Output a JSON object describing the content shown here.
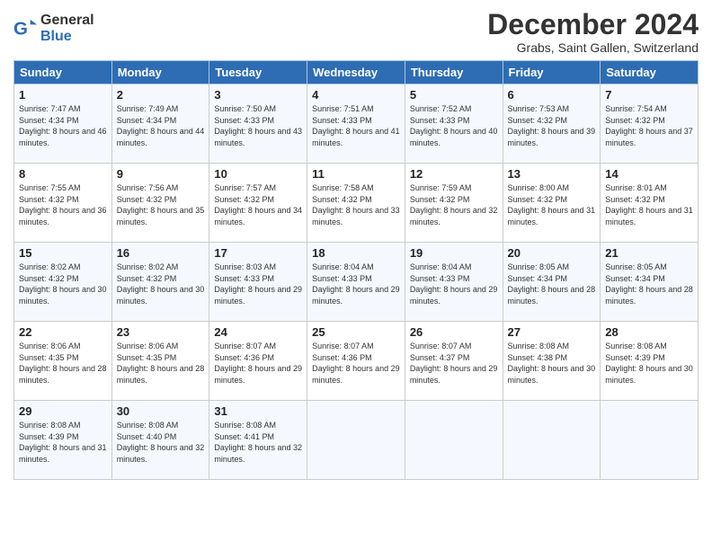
{
  "header": {
    "logo_general": "General",
    "logo_blue": "Blue",
    "month_title": "December 2024",
    "subtitle": "Grabs, Saint Gallen, Switzerland"
  },
  "weekdays": [
    "Sunday",
    "Monday",
    "Tuesday",
    "Wednesday",
    "Thursday",
    "Friday",
    "Saturday"
  ],
  "weeks": [
    [
      {
        "day": "1",
        "sunrise": "Sunrise: 7:47 AM",
        "sunset": "Sunset: 4:34 PM",
        "daylight": "Daylight: 8 hours and 46 minutes."
      },
      {
        "day": "2",
        "sunrise": "Sunrise: 7:49 AM",
        "sunset": "Sunset: 4:34 PM",
        "daylight": "Daylight: 8 hours and 44 minutes."
      },
      {
        "day": "3",
        "sunrise": "Sunrise: 7:50 AM",
        "sunset": "Sunset: 4:33 PM",
        "daylight": "Daylight: 8 hours and 43 minutes."
      },
      {
        "day": "4",
        "sunrise": "Sunrise: 7:51 AM",
        "sunset": "Sunset: 4:33 PM",
        "daylight": "Daylight: 8 hours and 41 minutes."
      },
      {
        "day": "5",
        "sunrise": "Sunrise: 7:52 AM",
        "sunset": "Sunset: 4:33 PM",
        "daylight": "Daylight: 8 hours and 40 minutes."
      },
      {
        "day": "6",
        "sunrise": "Sunrise: 7:53 AM",
        "sunset": "Sunset: 4:32 PM",
        "daylight": "Daylight: 8 hours and 39 minutes."
      },
      {
        "day": "7",
        "sunrise": "Sunrise: 7:54 AM",
        "sunset": "Sunset: 4:32 PM",
        "daylight": "Daylight: 8 hours and 37 minutes."
      }
    ],
    [
      {
        "day": "8",
        "sunrise": "Sunrise: 7:55 AM",
        "sunset": "Sunset: 4:32 PM",
        "daylight": "Daylight: 8 hours and 36 minutes."
      },
      {
        "day": "9",
        "sunrise": "Sunrise: 7:56 AM",
        "sunset": "Sunset: 4:32 PM",
        "daylight": "Daylight: 8 hours and 35 minutes."
      },
      {
        "day": "10",
        "sunrise": "Sunrise: 7:57 AM",
        "sunset": "Sunset: 4:32 PM",
        "daylight": "Daylight: 8 hours and 34 minutes."
      },
      {
        "day": "11",
        "sunrise": "Sunrise: 7:58 AM",
        "sunset": "Sunset: 4:32 PM",
        "daylight": "Daylight: 8 hours and 33 minutes."
      },
      {
        "day": "12",
        "sunrise": "Sunrise: 7:59 AM",
        "sunset": "Sunset: 4:32 PM",
        "daylight": "Daylight: 8 hours and 32 minutes."
      },
      {
        "day": "13",
        "sunrise": "Sunrise: 8:00 AM",
        "sunset": "Sunset: 4:32 PM",
        "daylight": "Daylight: 8 hours and 31 minutes."
      },
      {
        "day": "14",
        "sunrise": "Sunrise: 8:01 AM",
        "sunset": "Sunset: 4:32 PM",
        "daylight": "Daylight: 8 hours and 31 minutes."
      }
    ],
    [
      {
        "day": "15",
        "sunrise": "Sunrise: 8:02 AM",
        "sunset": "Sunset: 4:32 PM",
        "daylight": "Daylight: 8 hours and 30 minutes."
      },
      {
        "day": "16",
        "sunrise": "Sunrise: 8:02 AM",
        "sunset": "Sunset: 4:32 PM",
        "daylight": "Daylight: 8 hours and 30 minutes."
      },
      {
        "day": "17",
        "sunrise": "Sunrise: 8:03 AM",
        "sunset": "Sunset: 4:33 PM",
        "daylight": "Daylight: 8 hours and 29 minutes."
      },
      {
        "day": "18",
        "sunrise": "Sunrise: 8:04 AM",
        "sunset": "Sunset: 4:33 PM",
        "daylight": "Daylight: 8 hours and 29 minutes."
      },
      {
        "day": "19",
        "sunrise": "Sunrise: 8:04 AM",
        "sunset": "Sunset: 4:33 PM",
        "daylight": "Daylight: 8 hours and 29 minutes."
      },
      {
        "day": "20",
        "sunrise": "Sunrise: 8:05 AM",
        "sunset": "Sunset: 4:34 PM",
        "daylight": "Daylight: 8 hours and 28 minutes."
      },
      {
        "day": "21",
        "sunrise": "Sunrise: 8:05 AM",
        "sunset": "Sunset: 4:34 PM",
        "daylight": "Daylight: 8 hours and 28 minutes."
      }
    ],
    [
      {
        "day": "22",
        "sunrise": "Sunrise: 8:06 AM",
        "sunset": "Sunset: 4:35 PM",
        "daylight": "Daylight: 8 hours and 28 minutes."
      },
      {
        "day": "23",
        "sunrise": "Sunrise: 8:06 AM",
        "sunset": "Sunset: 4:35 PM",
        "daylight": "Daylight: 8 hours and 28 minutes."
      },
      {
        "day": "24",
        "sunrise": "Sunrise: 8:07 AM",
        "sunset": "Sunset: 4:36 PM",
        "daylight": "Daylight: 8 hours and 29 minutes."
      },
      {
        "day": "25",
        "sunrise": "Sunrise: 8:07 AM",
        "sunset": "Sunset: 4:36 PM",
        "daylight": "Daylight: 8 hours and 29 minutes."
      },
      {
        "day": "26",
        "sunrise": "Sunrise: 8:07 AM",
        "sunset": "Sunset: 4:37 PM",
        "daylight": "Daylight: 8 hours and 29 minutes."
      },
      {
        "day": "27",
        "sunrise": "Sunrise: 8:08 AM",
        "sunset": "Sunset: 4:38 PM",
        "daylight": "Daylight: 8 hours and 30 minutes."
      },
      {
        "day": "28",
        "sunrise": "Sunrise: 8:08 AM",
        "sunset": "Sunset: 4:39 PM",
        "daylight": "Daylight: 8 hours and 30 minutes."
      }
    ],
    [
      {
        "day": "29",
        "sunrise": "Sunrise: 8:08 AM",
        "sunset": "Sunset: 4:39 PM",
        "daylight": "Daylight: 8 hours and 31 minutes."
      },
      {
        "day": "30",
        "sunrise": "Sunrise: 8:08 AM",
        "sunset": "Sunset: 4:40 PM",
        "daylight": "Daylight: 8 hours and 32 minutes."
      },
      {
        "day": "31",
        "sunrise": "Sunrise: 8:08 AM",
        "sunset": "Sunset: 4:41 PM",
        "daylight": "Daylight: 8 hours and 32 minutes."
      },
      null,
      null,
      null,
      null
    ]
  ]
}
